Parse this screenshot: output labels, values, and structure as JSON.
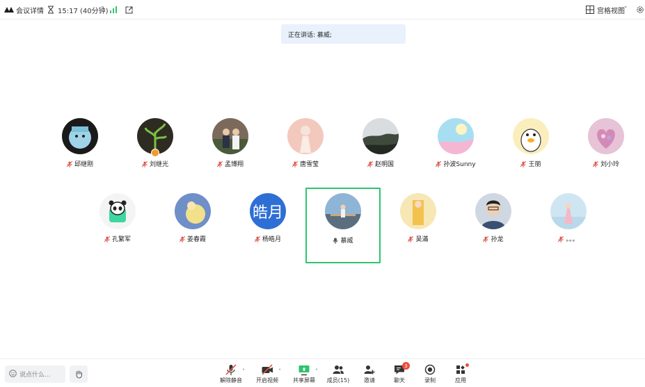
{
  "topbar": {
    "logo_icon": "tencent-meeting-logo-icon",
    "title": "会议详情",
    "timer": "15:17 (40分钟)",
    "timer_caret": "˅",
    "view_label": "宫格视图",
    "view_caret": "˅"
  },
  "speaking_banner": "正在讲话: 慕威;",
  "participants": [
    {
      "name": "邱继刚",
      "muted": true
    },
    {
      "name": "刘继光",
      "muted": true
    },
    {
      "name": "孟博翔",
      "muted": true
    },
    {
      "name": "唐雪莹",
      "muted": true
    },
    {
      "name": "赵明国",
      "muted": true
    },
    {
      "name": "孙波Sunny",
      "muted": true
    },
    {
      "name": "王丽",
      "muted": true
    },
    {
      "name": "刘小玲",
      "muted": true
    },
    {
      "name": "孔繁军",
      "muted": true
    },
    {
      "name": "姜春霞",
      "muted": true
    },
    {
      "name": "杨皓月",
      "muted": true,
      "avatar_text": "皓月"
    },
    {
      "name": "慕威",
      "muted": false,
      "speaking": true
    },
    {
      "name": "吴滿",
      "muted": true
    },
    {
      "name": "孙龙",
      "muted": true
    },
    {
      "name": "。。。",
      "muted": true
    }
  ],
  "bottombar": {
    "chat_placeholder": "说点什么...",
    "controls": [
      {
        "label": "解除静音",
        "icon": "mic-muted-icon"
      },
      {
        "label": "开启视频",
        "icon": "video-off-icon"
      },
      {
        "label": "共享屏幕",
        "icon": "share-screen-icon"
      },
      {
        "label": "成员(15)",
        "icon": "members-icon"
      },
      {
        "label": "邀请",
        "icon": "invite-icon"
      },
      {
        "label": "聊天",
        "icon": "chat-icon",
        "badge": "3"
      },
      {
        "label": "录制",
        "icon": "record-icon"
      },
      {
        "label": "应用",
        "icon": "apps-icon"
      }
    ],
    "caret": "˄"
  },
  "colors": {
    "accent_green": "#2ec46d",
    "signal_green": "#2ec46d",
    "banner_bg": "#e8f1fc",
    "badge_red": "#f04b3a"
  }
}
